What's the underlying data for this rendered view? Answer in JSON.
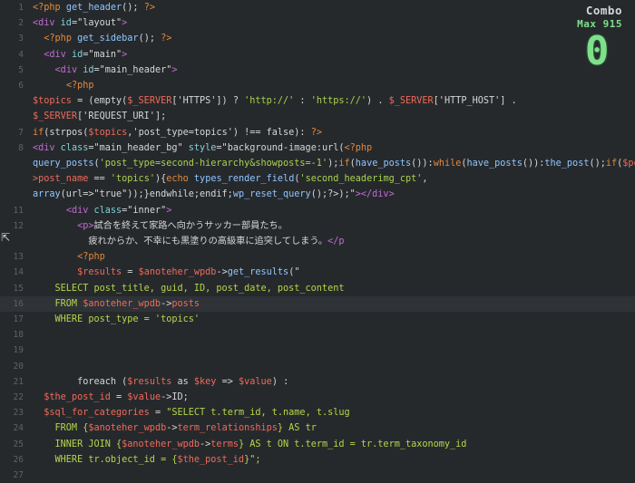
{
  "editor": {
    "lines": [
      {
        "n": "1",
        "tokens": [
          {
            "c": "k",
            "t": "<?php "
          },
          {
            "c": "f",
            "t": "get_header"
          },
          {
            "c": "p",
            "t": "(); "
          },
          {
            "c": "k",
            "t": "?>"
          }
        ]
      },
      {
        "n": "2",
        "tokens": [
          {
            "c": "t",
            "t": "<div "
          },
          {
            "c": "a",
            "t": "id"
          },
          {
            "c": "p",
            "t": "=\"layout\""
          },
          {
            "c": "t",
            "t": ">"
          }
        ]
      },
      {
        "n": "3",
        "tokens": [
          {
            "c": "p",
            "t": "  "
          },
          {
            "c": "k",
            "t": "<?php "
          },
          {
            "c": "f",
            "t": "get_sidebar"
          },
          {
            "c": "p",
            "t": "(); "
          },
          {
            "c": "k",
            "t": "?>"
          }
        ]
      },
      {
        "n": "4",
        "tokens": [
          {
            "c": "p",
            "t": "  "
          },
          {
            "c": "t",
            "t": "<div "
          },
          {
            "c": "a",
            "t": "id"
          },
          {
            "c": "p",
            "t": "=\"main\""
          },
          {
            "c": "t",
            "t": ">"
          }
        ]
      },
      {
        "n": "5",
        "tokens": [
          {
            "c": "p",
            "t": "    "
          },
          {
            "c": "t",
            "t": "<div "
          },
          {
            "c": "a",
            "t": "id"
          },
          {
            "c": "p",
            "t": "=\"main_header\""
          },
          {
            "c": "t",
            "t": ">"
          }
        ]
      },
      {
        "n": "6",
        "tokens": [
          {
            "c": "p",
            "t": "      "
          },
          {
            "c": "k",
            "t": "<?php"
          }
        ]
      },
      {
        "n": "",
        "tokens": [
          {
            "c": "v",
            "t": "$topics"
          },
          {
            "c": "p",
            "t": " = (empty("
          },
          {
            "c": "v",
            "t": "$_SERVER"
          },
          {
            "c": "p",
            "t": "['HTTPS']) ? "
          },
          {
            "c": "s",
            "t": "'http://'"
          },
          {
            "c": "p",
            "t": " : "
          },
          {
            "c": "s",
            "t": "'https://'"
          },
          {
            "c": "p",
            "t": ") . "
          },
          {
            "c": "v",
            "t": "$_SERVER"
          },
          {
            "c": "p",
            "t": "['HTTP_HOST'] ."
          }
        ]
      },
      {
        "n": "",
        "tokens": [
          {
            "c": "v",
            "t": "$_SERVER"
          },
          {
            "c": "p",
            "t": "['REQUEST_URI'];"
          }
        ]
      },
      {
        "n": "7",
        "tokens": [
          {
            "c": "k",
            "t": "if"
          },
          {
            "c": "p",
            "t": "(strpos("
          },
          {
            "c": "v",
            "t": "$topics"
          },
          {
            "c": "p",
            "t": ",'post_type=topics') !== false): "
          },
          {
            "c": "k",
            "t": "?>"
          }
        ]
      },
      {
        "n": "8",
        "tokens": [
          {
            "c": "t",
            "t": "<div "
          },
          {
            "c": "a",
            "t": "class"
          },
          {
            "c": "p",
            "t": "=\"main_header_bg\" "
          },
          {
            "c": "a",
            "t": "style"
          },
          {
            "c": "p",
            "t": "=\"background-image:url("
          },
          {
            "c": "k",
            "t": "<?php"
          }
        ]
      },
      {
        "n": "",
        "tokens": [
          {
            "c": "f",
            "t": "query_posts"
          },
          {
            "c": "p",
            "t": "("
          },
          {
            "c": "s",
            "t": "'post_type=second-hierarchy&showposts=-1'"
          },
          {
            "c": "p",
            "t": ");"
          },
          {
            "c": "k",
            "t": "if"
          },
          {
            "c": "p",
            "t": "("
          },
          {
            "c": "f",
            "t": "have_posts"
          },
          {
            "c": "p",
            "t": "()):"
          },
          {
            "c": "k",
            "t": "while"
          },
          {
            "c": "p",
            "t": "("
          },
          {
            "c": "f",
            "t": "have_posts"
          },
          {
            "c": "p",
            "t": "()):"
          },
          {
            "c": "f",
            "t": "the_post"
          },
          {
            "c": "p",
            "t": "();"
          },
          {
            "c": "k",
            "t": "if"
          },
          {
            "c": "p",
            "t": "("
          },
          {
            "c": "v",
            "t": "$post-"
          }
        ]
      },
      {
        "n": "",
        "tokens": [
          {
            "c": "v",
            "t": ">post_name"
          },
          {
            "c": "p",
            "t": " == "
          },
          {
            "c": "s",
            "t": "'topics'"
          },
          {
            "c": "p",
            "t": "){"
          },
          {
            "c": "k",
            "t": "echo "
          },
          {
            "c": "f",
            "t": "types_render_field"
          },
          {
            "c": "p",
            "t": "("
          },
          {
            "c": "s",
            "t": "'second_headerimg_cpt'"
          },
          {
            "c": "p",
            "t": ","
          }
        ]
      },
      {
        "n": "",
        "tokens": [
          {
            "c": "f",
            "t": "array"
          },
          {
            "c": "p",
            "t": "(url=>\"true\"));}endwhile;endif;"
          },
          {
            "c": "f",
            "t": "wp_reset_query"
          },
          {
            "c": "p",
            "t": "();?>);\""
          },
          {
            "c": "t",
            "t": "></div>"
          }
        ]
      },
      {
        "n": "11",
        "tokens": [
          {
            "c": "p",
            "t": "      "
          },
          {
            "c": "t",
            "t": "<div "
          },
          {
            "c": "a",
            "t": "class"
          },
          {
            "c": "p",
            "t": "=\"inner\""
          },
          {
            "c": "t",
            "t": ">"
          }
        ]
      },
      {
        "n": "12",
        "tokens": [
          {
            "c": "p",
            "t": "        "
          },
          {
            "c": "t",
            "t": "<p>"
          },
          {
            "c": "p",
            "t": "試合を終えて家路へ向かうサッカー部員たち。"
          }
        ]
      },
      {
        "n": "",
        "tokens": [
          {
            "c": "p",
            "t": "          疲れからか、不幸にも黒塗りの高級車に追突してしまう。"
          },
          {
            "c": "t",
            "t": "</p"
          }
        ]
      },
      {
        "n": "13",
        "tokens": [
          {
            "c": "p",
            "t": "        "
          },
          {
            "c": "k",
            "t": "<?php"
          }
        ]
      },
      {
        "n": "14",
        "tokens": [
          {
            "c": "p",
            "t": "        "
          },
          {
            "c": "v",
            "t": "$results"
          },
          {
            "c": "p",
            "t": " = "
          },
          {
            "c": "v",
            "t": "$anoteher_wpdb"
          },
          {
            "c": "p",
            "t": "->"
          },
          {
            "c": "f",
            "t": "get_results"
          },
          {
            "c": "p",
            "t": "(\""
          }
        ]
      },
      {
        "n": "15",
        "tokens": [
          {
            "c": "sq",
            "t": "    SELECT post_title, guid, ID, post_date, post_content"
          }
        ]
      },
      {
        "n": "16",
        "tokens": [
          {
            "c": "sq",
            "t": "    FROM "
          },
          {
            "c": "v",
            "t": "$anoteher_wpdb"
          },
          {
            "c": "p",
            "t": "->"
          },
          {
            "c": "v",
            "t": "posts"
          }
        ]
      },
      {
        "n": "17",
        "tokens": [
          {
            "c": "sq",
            "t": "    WHERE post_type = 'topics'"
          }
        ]
      },
      {
        "n": "18",
        "tokens": []
      },
      {
        "n": "19",
        "tokens": []
      },
      {
        "n": "20",
        "tokens": []
      },
      {
        "n": "21",
        "tokens": [
          {
            "c": "p",
            "t": "        foreach ("
          },
          {
            "c": "v",
            "t": "$results"
          },
          {
            "c": "p",
            "t": " as "
          },
          {
            "c": "v",
            "t": "$key"
          },
          {
            "c": "p",
            "t": " => "
          },
          {
            "c": "v",
            "t": "$value"
          },
          {
            "c": "p",
            "t": ") :"
          }
        ]
      },
      {
        "n": "22",
        "tokens": [
          {
            "c": "p",
            "t": "  "
          },
          {
            "c": "v",
            "t": "$the_post_id"
          },
          {
            "c": "p",
            "t": " = "
          },
          {
            "c": "v",
            "t": "$value"
          },
          {
            "c": "p",
            "t": "->ID;"
          }
        ]
      },
      {
        "n": "23",
        "tokens": [
          {
            "c": "p",
            "t": "  "
          },
          {
            "c": "v",
            "t": "$sql_for_categories"
          },
          {
            "c": "p",
            "t": " = "
          },
          {
            "c": "sq",
            "t": "\"SELECT t.term_id, t.name, t.slug"
          }
        ]
      },
      {
        "n": "24",
        "tokens": [
          {
            "c": "sq",
            "t": "    FROM {"
          },
          {
            "c": "v",
            "t": "$anoteher_wpdb"
          },
          {
            "c": "p",
            "t": "->"
          },
          {
            "c": "v",
            "t": "term_relationships"
          },
          {
            "c": "sq",
            "t": "} AS tr"
          }
        ]
      },
      {
        "n": "25",
        "tokens": [
          {
            "c": "sq",
            "t": "    INNER JOIN {"
          },
          {
            "c": "v",
            "t": "$anoteher_wpdb"
          },
          {
            "c": "p",
            "t": "->"
          },
          {
            "c": "v",
            "t": "terms"
          },
          {
            "c": "sq",
            "t": "} AS t ON t.term_id = tr.term_taxonomy_id"
          }
        ]
      },
      {
        "n": "26",
        "tokens": [
          {
            "c": "sq",
            "t": "    WHERE tr.object_id = {"
          },
          {
            "c": "v",
            "t": "$the_post_id"
          },
          {
            "c": "sq",
            "t": "}\";"
          }
        ]
      },
      {
        "n": "27",
        "tokens": []
      }
    ],
    "active_line_index": 19
  },
  "combo": {
    "title": "Combo",
    "max_label": "Max 915",
    "count": "0"
  },
  "colors": {
    "background": "#26292c",
    "combo_green": "#7ee08a"
  }
}
